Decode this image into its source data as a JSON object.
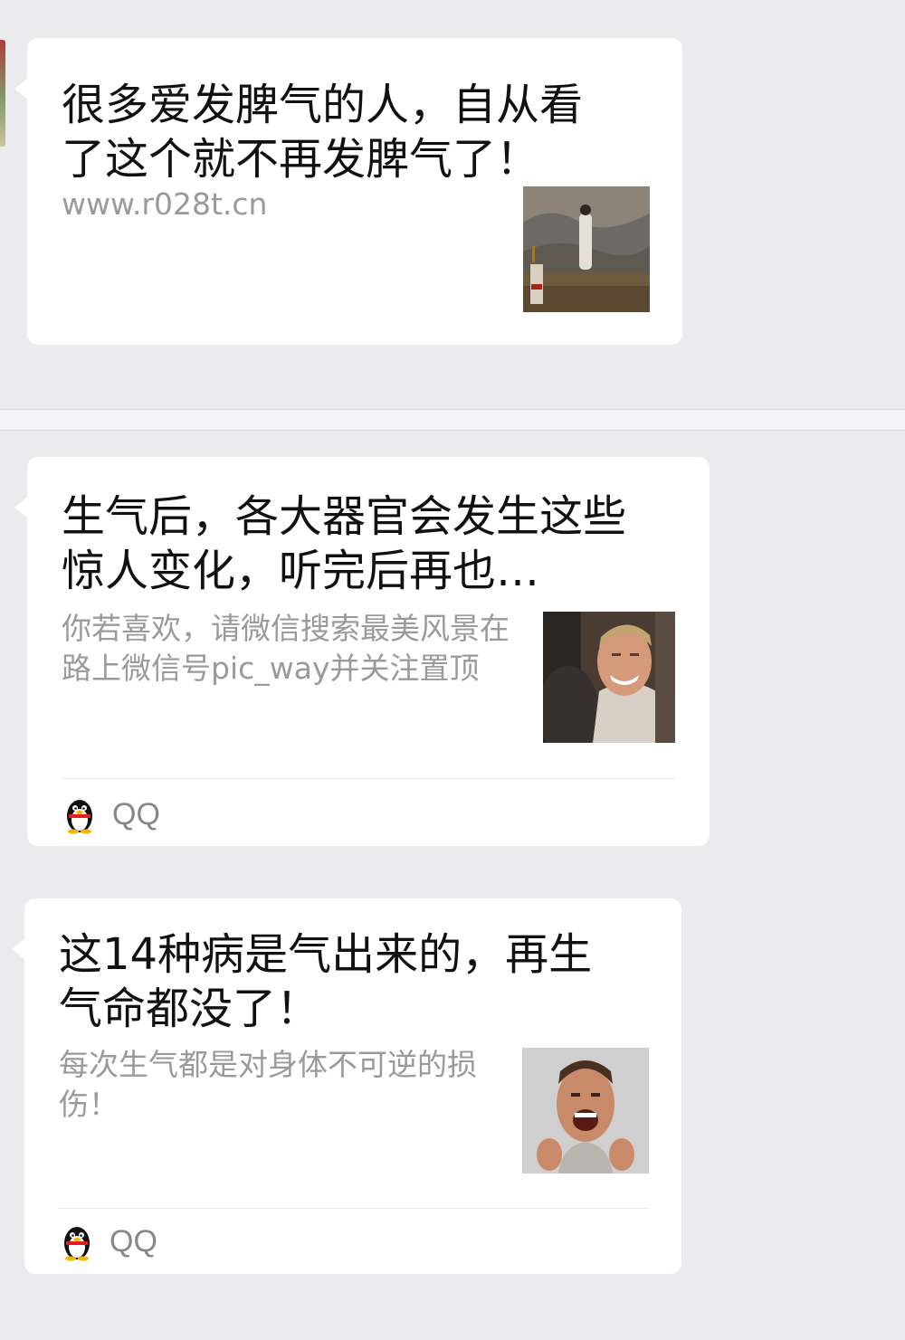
{
  "theme": {
    "page_background": "#ebebee",
    "card_background": "#ffffff",
    "title_color": "#111111",
    "description_color": "#9a9a9a",
    "source_color": "#888888"
  },
  "cards": [
    {
      "title": "很多爱发脾气的人，自从看了这个就不再发脾气了！",
      "description": "www.r028t.cn",
      "thumbnail_icon": "woman-on-mountain-photo"
    },
    {
      "title": "生气后，各大器官会发生这些惊人变化，听完后再也…",
      "description": "你若喜欢，请微信搜索最美风景在路上微信号pic_way并关注置顶",
      "thumbnail_icon": "angry-man-photo",
      "source": {
        "name": "QQ",
        "icon": "qq-penguin-icon"
      }
    },
    {
      "title": "这14种病是气出来的，再生气命都没了！",
      "description": "每次生气都是对身体不可逆的损伤！",
      "thumbnail_icon": "shouting-man-photo",
      "source": {
        "name": "QQ",
        "icon": "qq-penguin-icon"
      }
    }
  ]
}
